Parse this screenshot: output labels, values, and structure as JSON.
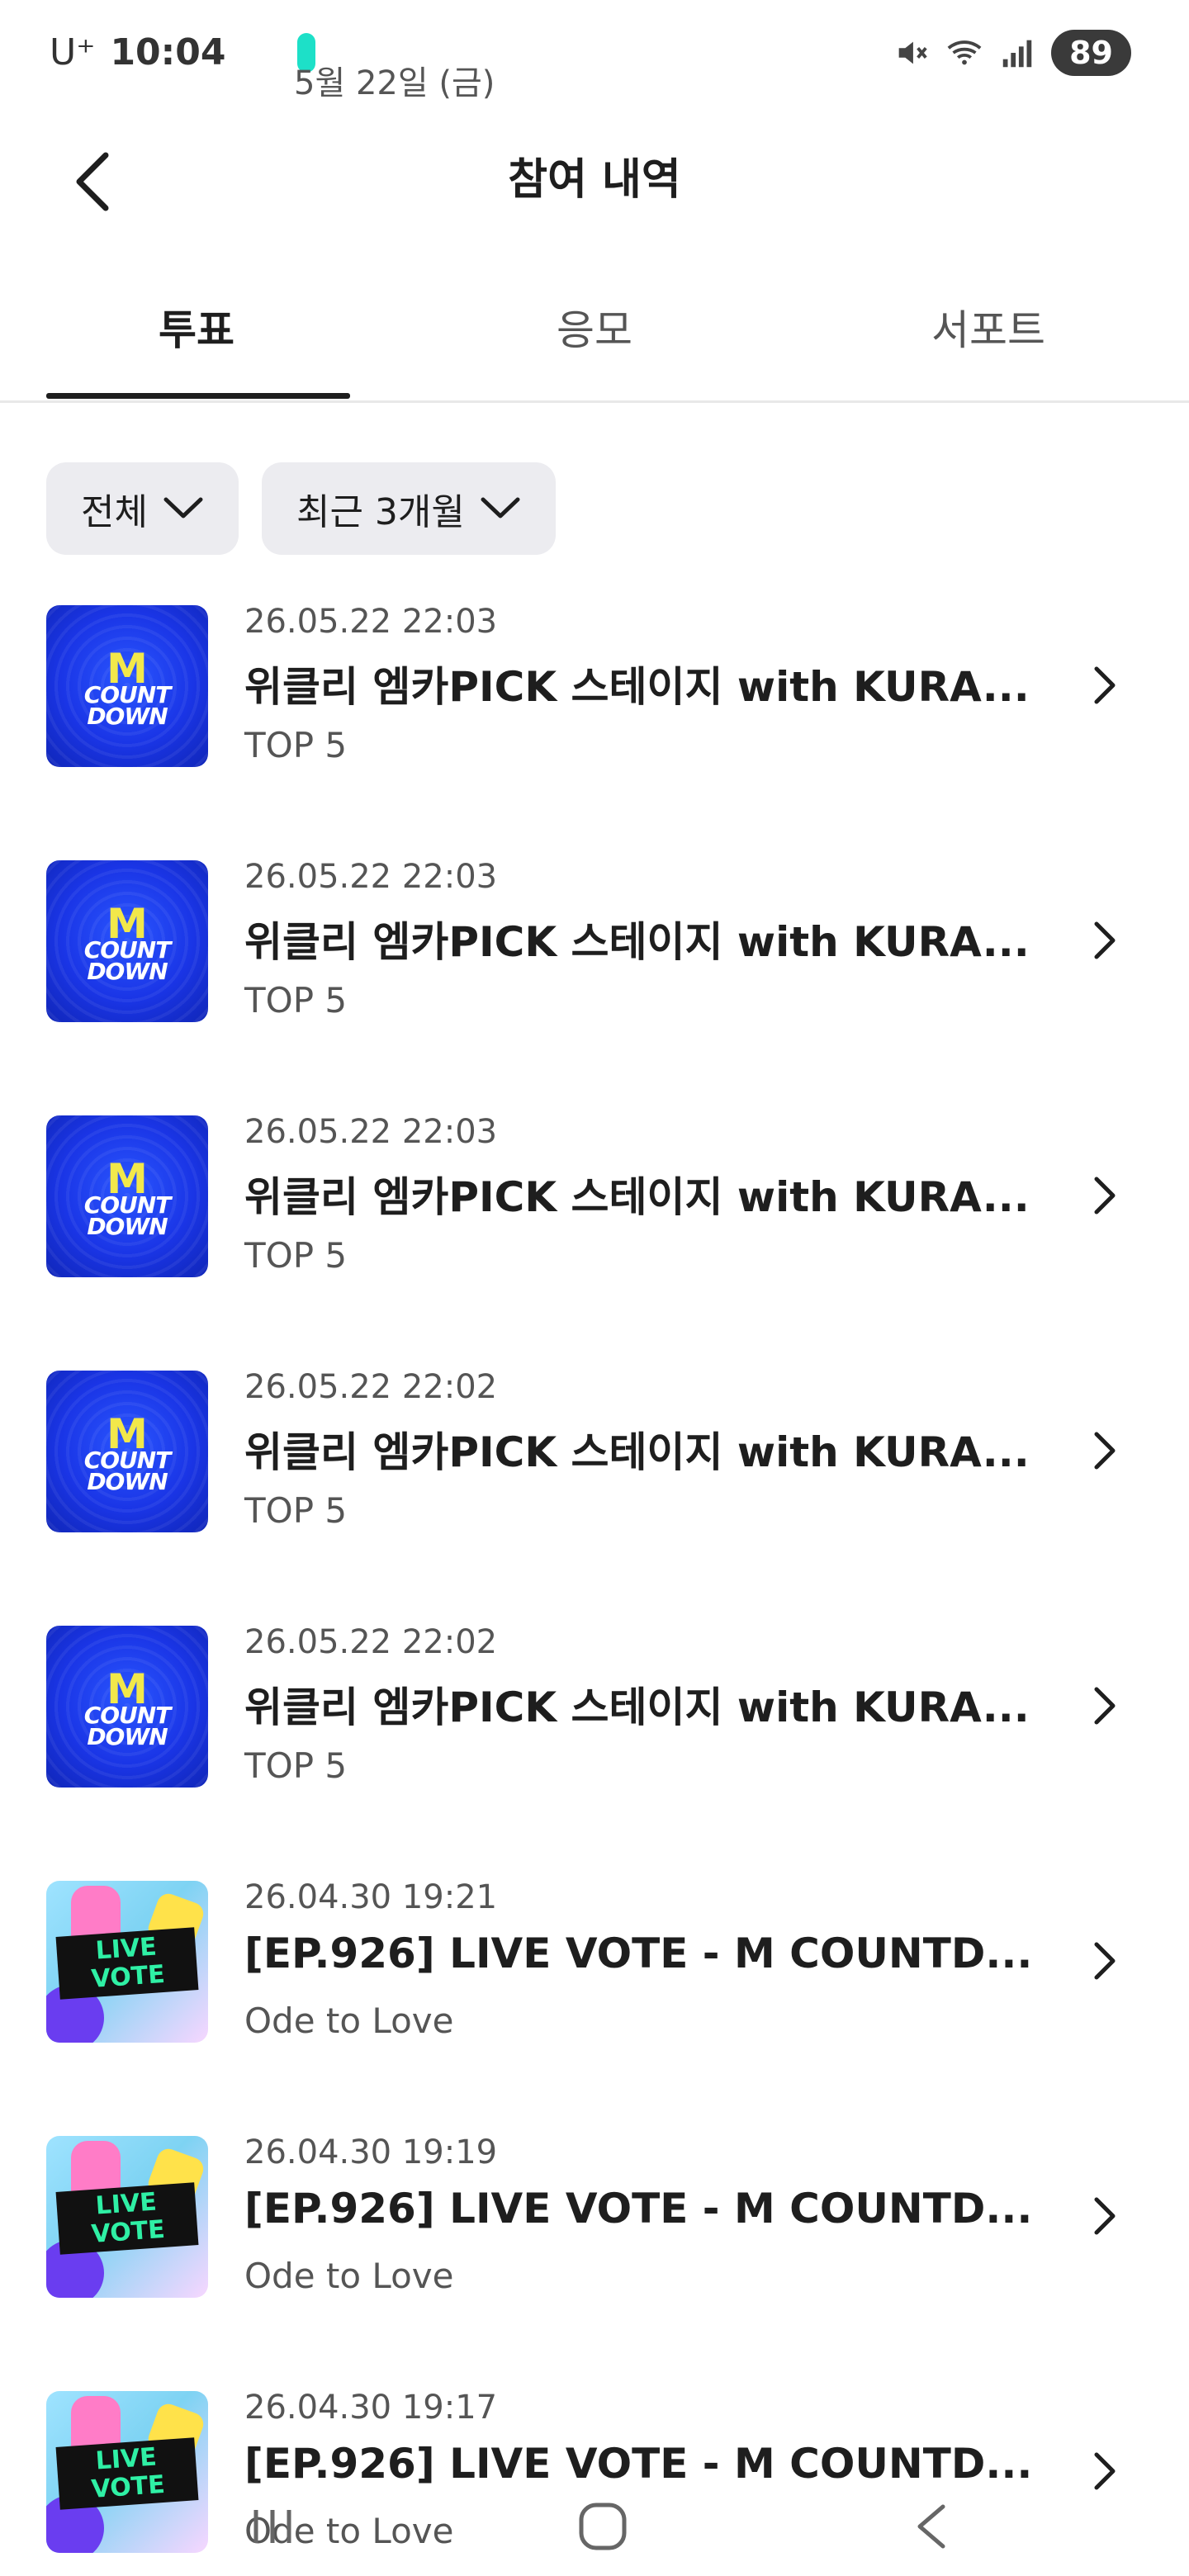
{
  "status_bar": {
    "carrier": "U⁺",
    "time": "10:04",
    "date": "5월 22일 (금)",
    "battery": "89"
  },
  "header": {
    "title": "참여 내역"
  },
  "tabs": [
    {
      "label": "투표",
      "active": true
    },
    {
      "label": "응모",
      "active": false
    },
    {
      "label": "서포트",
      "active": false
    }
  ],
  "filters": {
    "category": "전체",
    "period": "최근 3개월"
  },
  "items": [
    {
      "date": "26.05.22 22:03",
      "title": "위클리 엠카PICK 스테이지 with KURA...",
      "subtitle": "TOP 5",
      "thumb": "mcountdown"
    },
    {
      "date": "26.05.22 22:03",
      "title": "위클리 엠카PICK 스테이지 with KURA...",
      "subtitle": "TOP 5",
      "thumb": "mcountdown"
    },
    {
      "date": "26.05.22 22:03",
      "title": "위클리 엠카PICK 스테이지 with KURA...",
      "subtitle": "TOP 5",
      "thumb": "mcountdown"
    },
    {
      "date": "26.05.22 22:02",
      "title": "위클리 엠카PICK 스테이지 with KURA...",
      "subtitle": "TOP 5",
      "thumb": "mcountdown"
    },
    {
      "date": "26.05.22 22:02",
      "title": "위클리 엠카PICK 스테이지 with KURA...",
      "subtitle": "TOP 5",
      "thumb": "mcountdown"
    },
    {
      "date": "26.04.30 19:21",
      "title": "[EP.926] LIVE VOTE - M COUNTD...",
      "subtitle": "Ode to Love",
      "thumb": "livevote"
    },
    {
      "date": "26.04.30 19:19",
      "title": "[EP.926] LIVE VOTE - M COUNTD...",
      "subtitle": "Ode to Love",
      "thumb": "livevote"
    },
    {
      "date": "26.04.30 19:17",
      "title": "[EP.926] LIVE VOTE - M COUNTD...",
      "subtitle": "Ode to Love",
      "thumb": "livevote"
    }
  ],
  "thumb_text": {
    "mcountdown": {
      "logo": "M",
      "line1": "COUNT",
      "line2": "DOWN"
    },
    "livevote": {
      "line1": "LIVE",
      "line2": "VOTE"
    }
  },
  "colors": {
    "accent": "#1e1e1e",
    "chip_bg": "#ececf0",
    "mcd_blue": "#1a35e6",
    "live_green": "#2ff0a5"
  }
}
